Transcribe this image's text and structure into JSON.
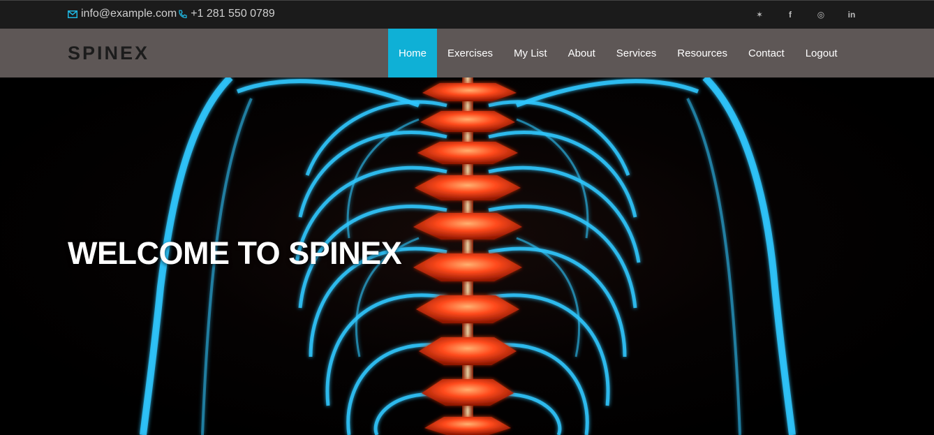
{
  "topbar": {
    "email": "info@example.com",
    "phone": "+1 281 550 0789",
    "social": [
      {
        "icon": "twitter-icon",
        "glyph": "✶"
      },
      {
        "icon": "facebook-icon",
        "glyph": "f"
      },
      {
        "icon": "instagram-icon",
        "glyph": "◎"
      },
      {
        "icon": "linkedin-icon",
        "glyph": "in"
      }
    ]
  },
  "navbar": {
    "brand": "SPINEX",
    "menu": [
      {
        "label": "Home",
        "active": true
      },
      {
        "label": "Exercises"
      },
      {
        "label": "My List"
      },
      {
        "label": "About"
      },
      {
        "label": "Services"
      },
      {
        "label": "Resources"
      },
      {
        "label": "Contact"
      },
      {
        "label": "Logout"
      }
    ]
  },
  "hero": {
    "title": "WELCOME TO SPINEX"
  },
  "colors": {
    "accent": "#0fb0d6",
    "navbar": "#5e5756",
    "topbar": "#1b1b1b",
    "bone_glow": "#2fc8ff",
    "spine": "#ff4a1c"
  }
}
